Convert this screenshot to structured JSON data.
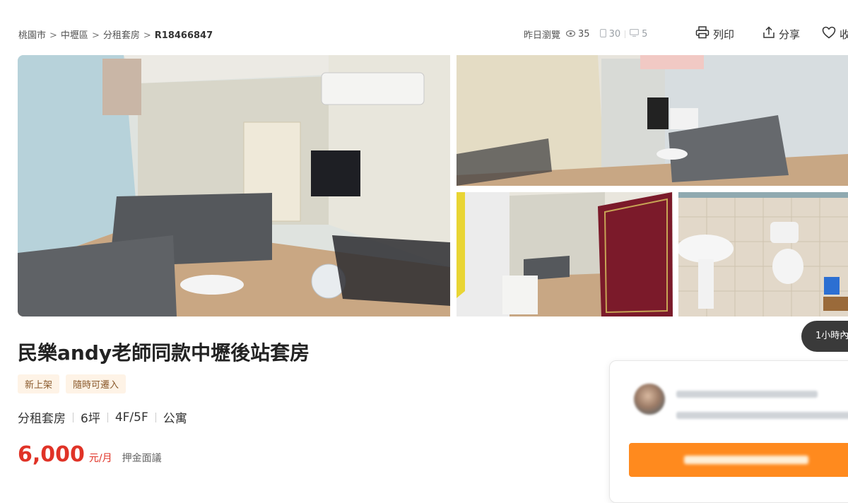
{
  "breadcrumb": {
    "items": [
      "桃園市",
      "中壢區",
      "分租套房"
    ],
    "separator": ">",
    "current": "R18466847"
  },
  "stats": {
    "yesterday_label": "昨日瀏覽",
    "views": "35",
    "saved": "30",
    "messages": "5"
  },
  "actions": {
    "print": "列印",
    "share": "分享",
    "favorite": "收"
  },
  "photos": {
    "recent_pill": "1小時內"
  },
  "listing": {
    "title": "民樂andy老師同款中壢後站套房",
    "tags": [
      "新上架",
      "隨時可遷入"
    ],
    "specs": [
      "分租套房",
      "6坪",
      "4F/5F",
      "公寓"
    ],
    "price": "6,000",
    "price_unit": "元/月",
    "deposit": "押金面議"
  },
  "colors": {
    "price": "#e03327",
    "tag_bg": "#fef3e6",
    "call_button": "#ff8a1e"
  }
}
